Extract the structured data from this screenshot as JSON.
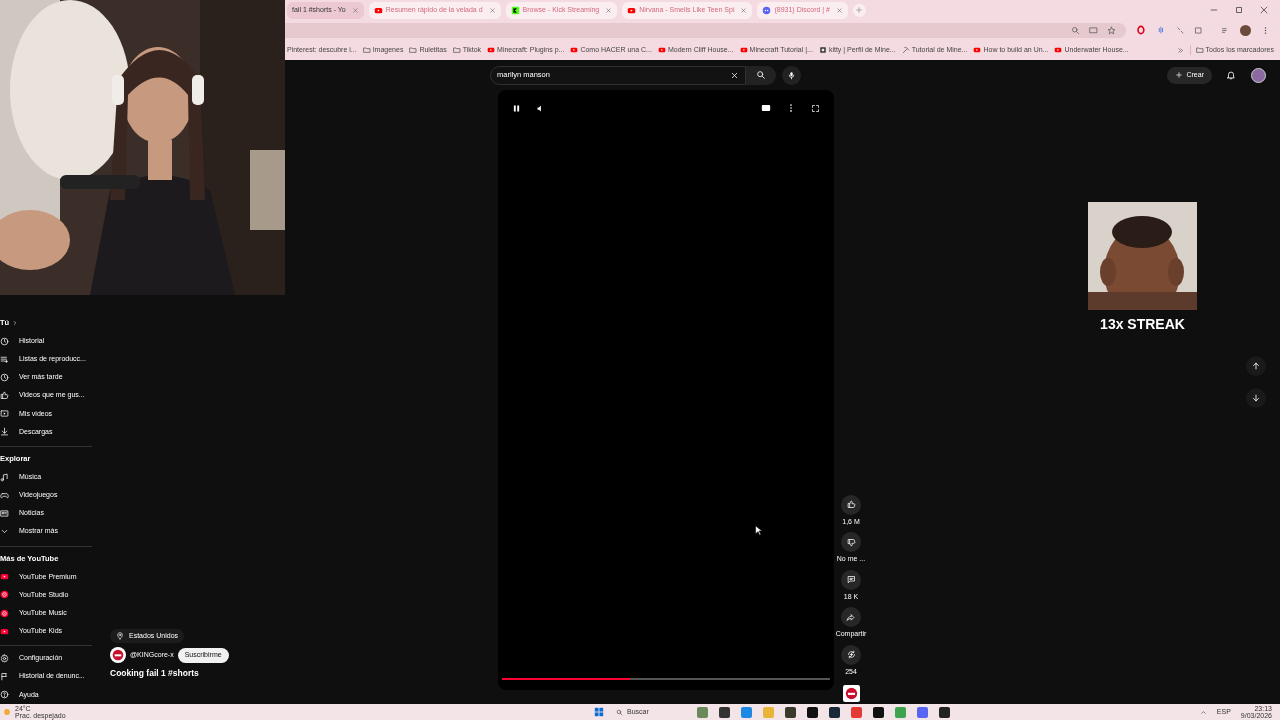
{
  "browser": {
    "tabs": [
      {
        "label": "fail 1 #shorts - Yo",
        "kind": "plain",
        "selected": true
      },
      {
        "label": "Resumen rápido de la velada d",
        "kind": "youtube",
        "selected": false
      },
      {
        "label": "Browse - Kick Streaming",
        "kind": "kick",
        "selected": false
      },
      {
        "label": "Nirvana - Smells Like Teen Spi",
        "kind": "youtube",
        "selected": false
      },
      {
        "label": "(8931) Discord | #",
        "kind": "discord",
        "selected": false
      }
    ],
    "bookmarks": [
      {
        "label": "Pinterest: descubre i...",
        "kind": "plain"
      },
      {
        "label": "Imagenes",
        "kind": "folder"
      },
      {
        "label": "Ruletitas",
        "kind": "folder"
      },
      {
        "label": "Tiktok",
        "kind": "folder"
      },
      {
        "label": "Minecraft: Plugins p...",
        "kind": "youtube"
      },
      {
        "label": "Como HACER una C...",
        "kind": "youtube"
      },
      {
        "label": "Modern Cliff House...",
        "kind": "youtube"
      },
      {
        "label": "Minecraft Tutorial |...",
        "kind": "youtube"
      },
      {
        "label": "kitty | Perfil de Mine...",
        "kind": "square"
      },
      {
        "label": "Tutorial de Mine...",
        "kind": "pick"
      },
      {
        "label": "How to build an Un...",
        "kind": "youtube"
      },
      {
        "label": "Underwater House...",
        "kind": "youtube"
      }
    ],
    "all_bookmarks": "Todos los marcadores"
  },
  "sidebar": {
    "sections": [
      {
        "title": "Tú",
        "items": [
          {
            "label": "Historial",
            "kind": "history"
          },
          {
            "label": "Listas de reproducc...",
            "kind": "list"
          },
          {
            "label": "Ver más tarde",
            "kind": "clock"
          },
          {
            "label": "Videos que me gus...",
            "kind": "like"
          },
          {
            "label": "Mis videos",
            "kind": "video"
          },
          {
            "label": "Descargas",
            "kind": "download"
          }
        ]
      },
      {
        "title": "Explorar",
        "items": [
          {
            "label": "Música",
            "kind": "music"
          },
          {
            "label": "Videojuegos",
            "kind": "gaming"
          },
          {
            "label": "Noticias",
            "kind": "news"
          },
          {
            "label": "Mostrar más",
            "kind": "chevron"
          }
        ]
      },
      {
        "title": "Más de YouTube",
        "items": [
          {
            "label": "YouTube Premium",
            "kind": "yt"
          },
          {
            "label": "YouTube Studio",
            "kind": "ytcircle"
          },
          {
            "label": "YouTube Music",
            "kind": "ytcircle"
          },
          {
            "label": "YouTube Kids",
            "kind": "yt"
          }
        ]
      },
      {
        "items": [
          {
            "label": "Configuración",
            "kind": "settings"
          },
          {
            "label": "Historial de denunc...",
            "kind": "flag"
          },
          {
            "label": "Ayuda",
            "kind": "help"
          }
        ]
      }
    ]
  },
  "search": {
    "value": "marilyn manson"
  },
  "header": {
    "create": "Crear"
  },
  "short": {
    "location": "Estados Unidos",
    "channel": "@KINGcore-x",
    "subscribe": "Suscribirme",
    "title": "Cooking fail 1 #shorts",
    "progress": {
      "level": 0.39
    }
  },
  "actions": [
    {
      "kind": "like",
      "label": "1,6 M"
    },
    {
      "kind": "dislike",
      "label": "No me ..."
    },
    {
      "kind": "comment",
      "label": "18 K"
    },
    {
      "kind": "share",
      "label": "Compartir"
    },
    {
      "kind": "remix",
      "label": "254"
    }
  ],
  "overlay": {
    "streak": "13x STREAK"
  },
  "taskbar": {
    "temperature": "24°C",
    "weather": "Prac. despejado",
    "search": "Buscar",
    "language": "ESP",
    "time": "23:13",
    "date": "9/03/2026"
  }
}
